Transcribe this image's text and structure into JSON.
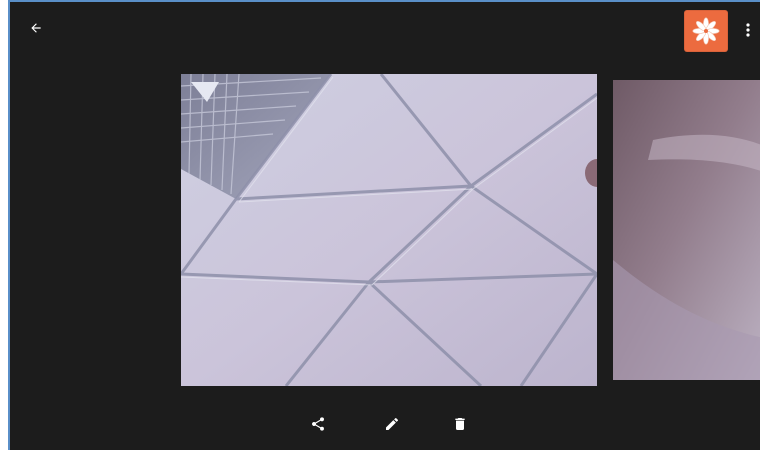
{
  "viewer": {
    "title": "",
    "background_color": "#1c1c1c",
    "accent_color": "#5a8fc8"
  },
  "toolbar": {
    "back_icon": "arrow-left-icon",
    "app_icon": "asterisk-flower-icon",
    "app_icon_color": "#ec6b3f",
    "menu_icon": "more-vert-icon"
  },
  "photos": {
    "current": {
      "subject": "ceiling tiles",
      "icon": "photo-icon"
    },
    "next": {
      "icon": "photo-icon"
    }
  },
  "actions": [
    {
      "name": "share",
      "icon": "share-icon"
    },
    {
      "name": "edit",
      "icon": "pencil-icon"
    },
    {
      "name": "delete",
      "icon": "trash-icon"
    }
  ]
}
